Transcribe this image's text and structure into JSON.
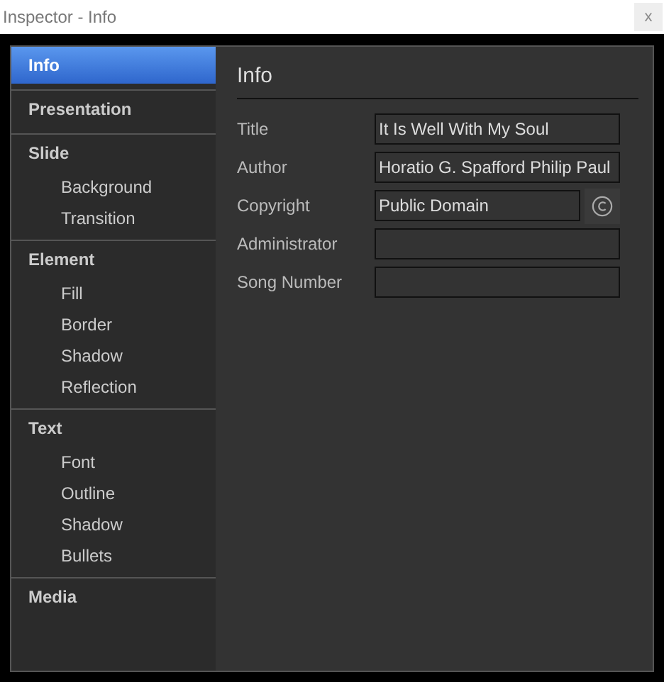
{
  "window": {
    "title": "Inspector - Info",
    "close": "x"
  },
  "sidebar": {
    "sections": [
      {
        "label": "Info",
        "selected": true
      },
      {
        "label": "Presentation",
        "selected": false
      },
      {
        "label": "Slide",
        "selected": false,
        "children": [
          {
            "label": "Background",
            "selected": false
          },
          {
            "label": "Transition",
            "selected": false
          }
        ]
      },
      {
        "label": "Element",
        "selected": false,
        "children": [
          {
            "label": "Fill",
            "selected": false
          },
          {
            "label": "Border",
            "selected": false
          },
          {
            "label": "Shadow",
            "selected": false
          },
          {
            "label": "Reflection",
            "selected": false
          }
        ]
      },
      {
        "label": "Text",
        "selected": false,
        "children": [
          {
            "label": "Font",
            "selected": false
          },
          {
            "label": "Outline",
            "selected": false
          },
          {
            "label": "Shadow",
            "selected": false
          },
          {
            "label": "Bullets",
            "selected": false
          }
        ]
      },
      {
        "label": "Media",
        "selected": false
      }
    ]
  },
  "panel": {
    "heading": "Info",
    "fields": [
      {
        "label": "Title",
        "value": "It Is Well With My Soul",
        "kind": "text"
      },
      {
        "label": "Author",
        "value": "Horatio G. Spafford Philip Paul",
        "kind": "text"
      },
      {
        "label": "Copyright",
        "value": "Public Domain",
        "kind": "copyright"
      },
      {
        "label": "Administrator",
        "kind": "text"
      },
      {
        "label": "Song Number",
        "kind": "text"
      }
    ]
  }
}
